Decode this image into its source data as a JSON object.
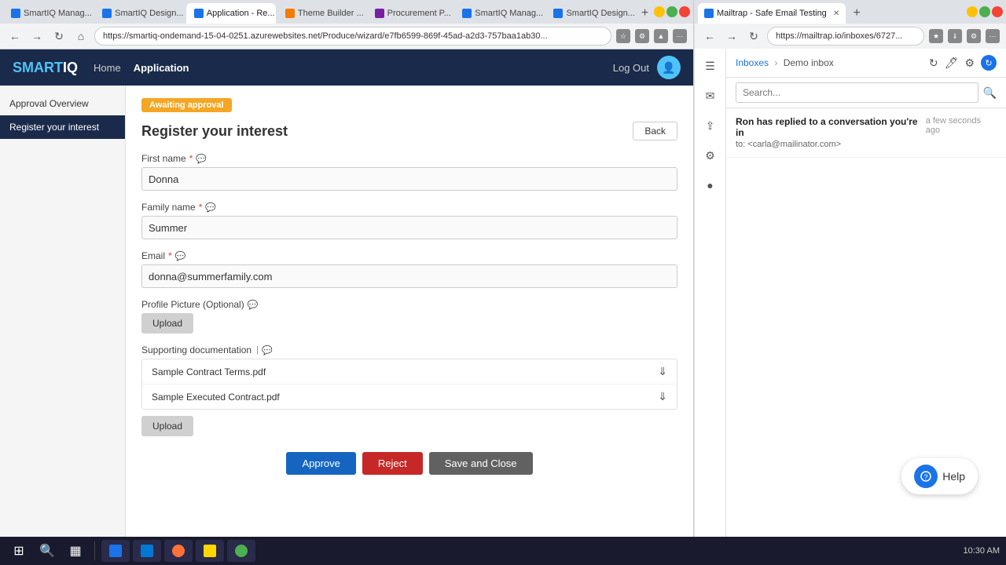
{
  "browser": {
    "tabs": [
      {
        "id": "tab1",
        "label": "SmartIQ Manag...",
        "favicon": "blue",
        "active": false
      },
      {
        "id": "tab2",
        "label": "SmartIQ Design...",
        "favicon": "blue",
        "active": false
      },
      {
        "id": "tab3",
        "label": "Application - Re...",
        "favicon": "blue",
        "active": true
      },
      {
        "id": "tab4",
        "label": "Theme Builder ...",
        "favicon": "orange",
        "active": false
      },
      {
        "id": "tab5",
        "label": "Procurement P...",
        "favicon": "purple",
        "active": false
      },
      {
        "id": "tab6",
        "label": "SmartIQ Manag...",
        "favicon": "blue",
        "active": false
      },
      {
        "id": "tab7",
        "label": "SmartIQ Design...",
        "favicon": "blue",
        "active": false
      }
    ],
    "address": "https://smartiq-ondemand-15-04-0251.azurewebsites.net/Produce/wizard/e7fb6599-869f-45ad-a2d3-757baa1ab30..."
  },
  "app": {
    "logo": "SMART IQ",
    "nav": [
      {
        "label": "Home",
        "active": false
      },
      {
        "label": "Application",
        "active": true
      }
    ],
    "logout_label": "Log Out"
  },
  "sidebar": {
    "items": [
      {
        "label": "Approval Overview",
        "active": false
      },
      {
        "label": "Register your interest",
        "active": true
      }
    ]
  },
  "main": {
    "status_badge": "Awaiting approval",
    "page_title": "Register your interest",
    "back_button": "Back",
    "fields": [
      {
        "label": "First name",
        "required": true,
        "value": "Donna"
      },
      {
        "label": "Family name",
        "required": true,
        "value": "Summer"
      },
      {
        "label": "Email",
        "required": true,
        "value": "donna@summerfamily.com"
      },
      {
        "label": "Profile Picture (Optional)",
        "required": false,
        "value": ""
      }
    ],
    "supporting_docs_label": "Supporting documentation",
    "files": [
      {
        "name": "Sample Contract Terms.pdf"
      },
      {
        "name": "Sample Executed Contract.pdf"
      }
    ],
    "upload_button1": "Upload",
    "upload_button2": "Upload",
    "buttons": {
      "approve": "Approve",
      "reject": "Reject",
      "save_close": "Save and Close"
    }
  },
  "mailtrap": {
    "tab_label": "Mailtrap - Safe Email Testing",
    "address": "https://mailtrap.io/inboxes/6727...",
    "breadcrumb": {
      "inboxes": "Inboxes",
      "demo": "Demo inbox"
    },
    "search_placeholder": "Search...",
    "mail_item": {
      "from": "Ron has replied to a conversation you're in",
      "to": "to: <carla@mailinator.com>",
      "time": "a few seconds ago"
    },
    "help_button": "Help"
  },
  "taskbar": {
    "time": "10:30 AM",
    "apps": [
      {
        "label": "File Explorer"
      },
      {
        "label": "Outlook"
      },
      {
        "label": "Firefox"
      },
      {
        "label": "Folder"
      }
    ]
  }
}
